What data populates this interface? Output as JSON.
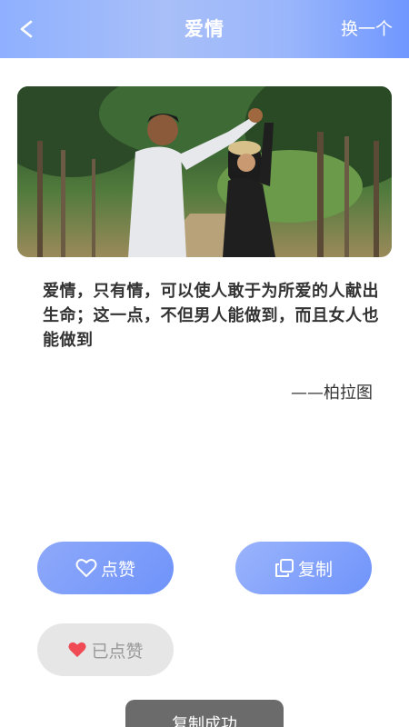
{
  "header": {
    "back_label": "<",
    "title": "爱情",
    "change_label": "换一个"
  },
  "quote": {
    "text": "爱情，只有情，可以使人敢于为所爱的人献出生命；这一点，不但男人能做到，而且女人也能做到",
    "author": "——柏拉图"
  },
  "actions": {
    "like_label": "点赞",
    "copy_label": "复制",
    "liked_label": "已点赞"
  },
  "toast": {
    "text": "复制成功"
  },
  "colors": {
    "accent": "#7a9cfb",
    "liked_heart": "#f04a55",
    "toast_bg": "#6b6b6b"
  },
  "icons": {
    "back": "chevron-left-icon",
    "like": "heart-outline-icon",
    "copy": "copy-icon",
    "liked": "heart-filled-icon"
  }
}
